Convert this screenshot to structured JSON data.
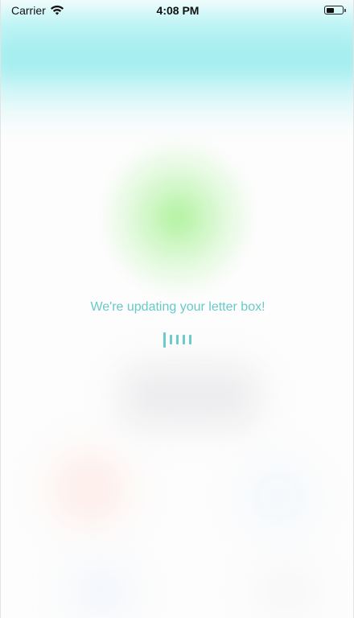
{
  "status_bar": {
    "carrier": "Carrier",
    "time": "4:08 PM",
    "wifi_icon": "wifi-icon",
    "battery_icon": "battery-icon"
  },
  "loading": {
    "message": "We're updating your letter box!",
    "indicator_icon": "loading-bars-icon",
    "accent_color": "#68c9c9"
  }
}
